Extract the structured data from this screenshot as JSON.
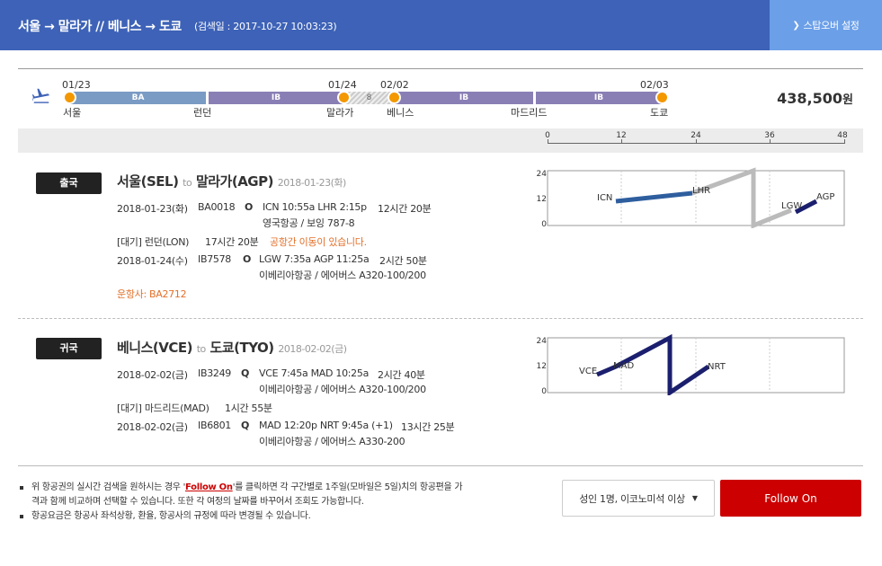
{
  "header": {
    "title": "서울 → 말라가 // 베니스 → 도쿄",
    "search_date": "(검색일 : 2017-10-27 10:03:23)",
    "stopover_label": "스탑오버 설정"
  },
  "timeline": {
    "segments": [
      {
        "label": "BA",
        "type": "ba"
      },
      {
        "label": "IB",
        "type": "ib"
      },
      {
        "label": "8",
        "type": "stay"
      },
      {
        "label": "IB",
        "type": "ib"
      },
      {
        "label": "IB",
        "type": "ib"
      }
    ],
    "dates": [
      "01/23",
      "01/24",
      "02/02",
      "02/03"
    ],
    "cities": [
      "서울",
      "런던",
      "말라가",
      "베니스",
      "마드리드",
      "도쿄"
    ],
    "price": "438,500",
    "currency": "원"
  },
  "scale": {
    "ticks": [
      "0",
      "12",
      "24",
      "36",
      "48"
    ]
  },
  "outbound": {
    "badge": "출국",
    "from": "서울(SEL)",
    "to_word": "to",
    "to": "말라가(AGP)",
    "date": "2018-01-23(화)",
    "flight1": {
      "date": "2018-01-23(화)",
      "code": "BA0018",
      "class": "O",
      "times": "ICN 10:55a LHR 2:15p",
      "duration": "12시간 20분",
      "airline": "영국항공 / 보잉 787-8"
    },
    "layover": {
      "text": "[대기] 런던(LON)",
      "duration": "17시간 20분",
      "warning": "공항간 이동이 있습니다."
    },
    "flight2": {
      "date": "2018-01-24(수)",
      "code": "IB7578",
      "class": "O",
      "times": "LGW 7:35a AGP 11:25a",
      "duration": "2시간 50분",
      "airline": "이베리아항공 / 에어버스 A320-100/200"
    },
    "operator": "운항사: BA2712",
    "chart": {
      "yticks": [
        "24",
        "12",
        "0"
      ],
      "labels": [
        "ICN",
        "LHR",
        "LGW",
        "AGP"
      ]
    }
  },
  "inbound": {
    "badge": "귀국",
    "from": "베니스(VCE)",
    "to_word": "to",
    "to": "도쿄(TYO)",
    "date": "2018-02-02(금)",
    "flight1": {
      "date": "2018-02-02(금)",
      "code": "IB3249",
      "class": "Q",
      "times": "VCE 7:45a MAD 10:25a",
      "duration": "2시간 40분",
      "airline": "이베리아항공 / 에어버스 A320-100/200"
    },
    "layover": {
      "text": "[대기] 마드리드(MAD)",
      "duration": "1시간 55분"
    },
    "flight2": {
      "date": "2018-02-02(금)",
      "code": "IB6801",
      "class": "Q",
      "times": "MAD 12:20p NRT 9:45a (+1)",
      "duration": "13시간 25분",
      "airline": "이베리아항공 / 에어버스 A330-200"
    },
    "chart": {
      "yticks": [
        "24",
        "12",
        "0"
      ],
      "labels": [
        "VCE",
        "MAD",
        "NRT"
      ]
    }
  },
  "notes": {
    "line1_a": "위 항공권의 실시간 검색을 원하시는 경우 '",
    "line1_link": "Follow On",
    "line1_b": "'를 클릭하면 각 구간별로 1주일(모바일은 5일)치의 항공편을 가격과 함께 비교하며 선택할 수 있습니다. 또한 각 여정의 날짜를 바꾸어서 조회도 가능합니다.",
    "line2": "항공요금은 항공사 좌석상황, 환율, 항공사의 규정에 따라 변경될 수 있습니다."
  },
  "controls": {
    "passenger_select": "성인 1명, 이코노미석 이상",
    "follow_on": "Follow On"
  },
  "colors": {
    "header": "#3d62b7",
    "stopover": "#6b9fe8",
    "accent_orange": "#f39800",
    "follow_on": "#cc0000",
    "outbound_line": "#2e5e9e",
    "inbound_line": "#1b1f6e"
  }
}
